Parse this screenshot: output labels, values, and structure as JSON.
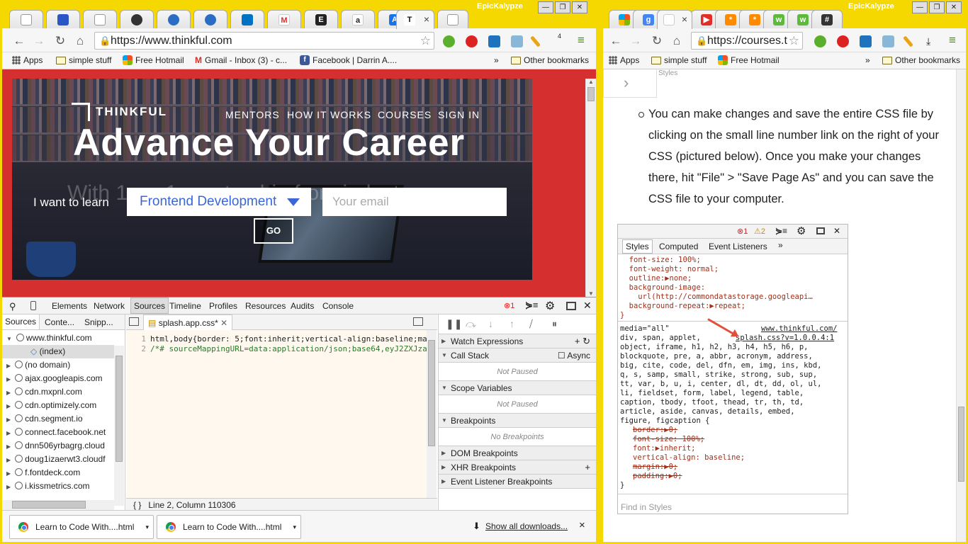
{
  "left_window": {
    "profile": "EpicKalypze",
    "active_tab_close": "×",
    "url": "https://www.thinkful.com",
    "extension_badge": "4",
    "bookmarks": [
      "Apps",
      "simple stuff",
      "Free Hotmail",
      "Gmail - Inbox (3) - c...",
      "Facebook | Darrin A...."
    ],
    "bookmarks_more": "»",
    "other_bookmarks": "Other bookmarks",
    "page": {
      "logo": "THINKFUL",
      "nav": [
        "MENTORS",
        "HOW IT WORKS",
        "COURSES",
        "SIGN IN"
      ],
      "headline": "Advance Your Career",
      "subheadline": "With 1-on-1 mentorship from industry",
      "i_want": "I want to learn",
      "course_select": "Frontend Development",
      "email_placeholder": "Your email",
      "go": "GO"
    },
    "devtools": {
      "tabs": [
        "Elements",
        "Network",
        "Sources",
        "Timeline",
        "Profiles",
        "Resources",
        "Audits",
        "Console"
      ],
      "error_count": "1",
      "sub_tabs": [
        "Sources",
        "Conte...",
        "Snipp..."
      ],
      "tree": [
        "www.thinkful.com",
        "(index)",
        "(no domain)",
        "ajax.googleapis.com",
        "cdn.mxpnl.com",
        "cdn.optimizely.com",
        "cdn.segment.io",
        "connect.facebook.net",
        "dnn506yrbagrg.cloud",
        "doug1izaerwt3.cloudf",
        "f.fontdeck.com",
        "i.kissmetrics.com"
      ],
      "file_tab": "splash.app.css*",
      "code_lines": [
        {
          "n": "1",
          "text": "html,body{border: 5;font:inherit;vertical-align:baseline;ma"
        },
        {
          "n": "2",
          "text": "/*# sourceMappingURL=data:application/json;base64,eyJ2ZXJza"
        }
      ],
      "status": "Line 2, Column 110306",
      "status_braces": "{ }",
      "right_sections": [
        {
          "label": "Watch Expressions",
          "open": false
        },
        {
          "label": "Call Stack",
          "open": true,
          "extra": "Async",
          "note": "Not Paused"
        },
        {
          "label": "Scope Variables",
          "open": true,
          "note": "Not Paused"
        },
        {
          "label": "Breakpoints",
          "open": true,
          "note": "No Breakpoints"
        },
        {
          "label": "DOM Breakpoints",
          "open": false
        },
        {
          "label": "XHR Breakpoints",
          "open": false
        },
        {
          "label": "Event Listener Breakpoints",
          "open": false
        }
      ]
    },
    "downloads": {
      "items": [
        "Learn to Code With....html",
        "Learn to Code With....html"
      ],
      "show_all": "Show all downloads...",
      "close": "×"
    }
  },
  "right_window": {
    "profile": "EpicKalypze",
    "active_tab_close": "×",
    "url": "https://courses.t",
    "bookmarks": [
      "Apps",
      "simple stuff",
      "Free Hotmail"
    ],
    "bookmarks_more": "»",
    "other_bookmarks": "Other bookmarks",
    "page": {
      "top_label": "Styles",
      "bullet": "You can make changes and save the entire CSS file by clicking on the small line number link on the right of your CSS (pictured below). Once you make your changes there, hit \"File\" > \"Save Page As\" and you can save the CSS file to your computer.",
      "shot": {
        "err": "1",
        "warn": "2",
        "tabs": [
          "Styles",
          "Computed",
          "Event Listeners"
        ],
        "more": "»",
        "block1": "  font-size: 100%;\n  font-weight: normal;\n  outline:▶none;\n  background-image:\n    url(http://commondatastorage.googleapi…\n  background-repeat:▶repeat;\n}",
        "media": "media=\"all\"",
        "site": "www.thinkful.com/",
        "file_link": "splash.css?v=1.0.0.4:1",
        "selectors": "div, span, applet,\nobject, iframe, h1, h2, h3, h4, h5, h6, p,\nblockquote, pre, a, abbr, acronym, address,\nbig, cite, code, del, dfn, em, img, ins, kbd,\nq, s, samp, small, strike, strong, sub, sup,\ntt, var, b, u, i, center, dl, dt, dd, ol, ul,\nli, fieldset, form, label, legend, table,\ncaption, tbody, tfoot, thead, tr, th, td,\narticle, aside, canvas, details, embed,\nfigure, figcaption {",
        "props": [
          {
            "text": "border:▶0;",
            "struck": true
          },
          {
            "text": "font-size: 100%;",
            "struck": true
          },
          {
            "text": "font:▶inherit;",
            "struck": false
          },
          {
            "text": "vertical-align: baseline;",
            "struck": false
          },
          {
            "text": "margin:▶0;",
            "struck": true
          },
          {
            "text": "padding:▶0;",
            "struck": true
          }
        ],
        "close_brace": "}",
        "find": "Find in Styles"
      }
    }
  },
  "colors": {
    "frame": "#f5d800",
    "thinkful_red": "#d62f2f",
    "link_blue": "#3b66d6"
  }
}
